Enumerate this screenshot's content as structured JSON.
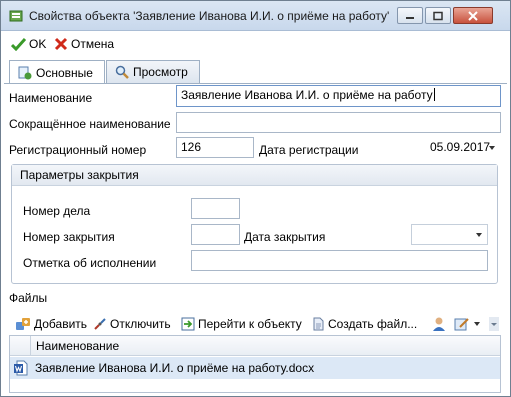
{
  "window": {
    "title": "Свойства объекта 'Заявление Иванова И.И. о приёме на работу'"
  },
  "toolbar": {
    "ok_label": "OK",
    "cancel_label": "Отмена"
  },
  "tabs": [
    {
      "label": "Основные",
      "icon": "general-tab-icon",
      "active": true
    },
    {
      "label": "Просмотр",
      "icon": "magnifier-icon",
      "active": false
    }
  ],
  "form": {
    "name_label": "Наименование",
    "name_value": "Заявление Иванова И.И. о приёме на работу",
    "short_name_label": "Сокращённое наименование",
    "short_name_value": "",
    "reg_number_label": "Регистрационный номер",
    "reg_number_value": "126",
    "reg_date_label": "Дата регистрации",
    "reg_date_value": "05.09.2017"
  },
  "closing": {
    "title": "Параметры закрытия",
    "case_number_label": "Номер дела",
    "case_number_value": "",
    "closing_number_label": "Номер закрытия",
    "closing_number_value": "",
    "closing_date_label": "Дата закрытия",
    "closing_date_value": "",
    "execution_mark_label": "Отметка об исполнении",
    "execution_mark_value": ""
  },
  "files": {
    "section_label": "Файлы",
    "toolbar": {
      "add_label": "Добавить",
      "detach_label": "Отключить",
      "goto_label": "Перейти к объекту",
      "create_label": "Создать файл..."
    },
    "columns": [
      "Наименование"
    ],
    "rows": [
      {
        "name": "Заявление Иванова И.И. о приёме на работу.docx",
        "icon": "word-document-icon"
      }
    ]
  },
  "colors": {
    "titlebar": "#c8d8ec",
    "selected_row": "#dce8f6",
    "ok_green": "#3a9a2a",
    "cancel_red": "#d02a1a"
  }
}
